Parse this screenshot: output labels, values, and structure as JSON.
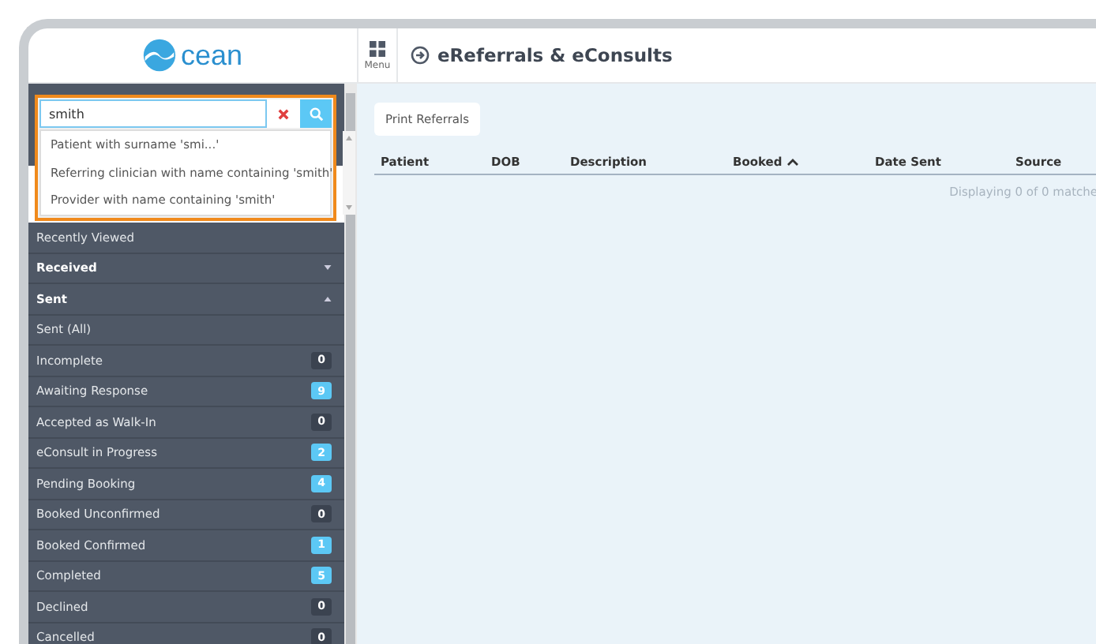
{
  "logo": {
    "text": "cean"
  },
  "header": {
    "menu_label": "Menu",
    "title": "eReferrals & eConsults"
  },
  "search": {
    "value": "smith",
    "suggestions": [
      "Patient with surname 'smi...'",
      "Referring clinician with name containing 'smith'",
      "Provider with name containing 'smith'"
    ]
  },
  "sidebar": {
    "items": [
      {
        "kind": "link",
        "label": "Recently Viewed"
      },
      {
        "kind": "section",
        "label": "Received",
        "expanded": false
      },
      {
        "kind": "section",
        "label": "Sent",
        "expanded": true
      },
      {
        "kind": "link",
        "label": "Sent (All)"
      },
      {
        "kind": "count",
        "label": "Incomplete",
        "count": "0",
        "color": "#3b4350"
      },
      {
        "kind": "count",
        "label": "Awaiting Response",
        "count": "9",
        "color": "#5cc8f5"
      },
      {
        "kind": "count",
        "label": "Accepted as Walk-In",
        "count": "0",
        "color": "#3b4350"
      },
      {
        "kind": "count",
        "label": "eConsult in Progress",
        "count": "2",
        "color": "#5cc8f5"
      },
      {
        "kind": "count",
        "label": "Pending Booking",
        "count": "4",
        "color": "#5cc8f5"
      },
      {
        "kind": "count",
        "label": "Booked Unconfirmed",
        "count": "0",
        "color": "#3b4350"
      },
      {
        "kind": "count",
        "label": "Booked Confirmed",
        "count": "1",
        "color": "#5cc8f5"
      },
      {
        "kind": "count",
        "label": "Completed",
        "count": "5",
        "color": "#5cc8f5"
      },
      {
        "kind": "count",
        "label": "Declined",
        "count": "0",
        "color": "#3b4350"
      },
      {
        "kind": "count",
        "label": "Cancelled",
        "count": "0",
        "color": "#3b4350"
      }
    ]
  },
  "toolbar": {
    "button": "Print Referrals"
  },
  "table": {
    "columns": [
      {
        "label": "Patient",
        "sorted": false
      },
      {
        "label": "DOB",
        "sorted": false
      },
      {
        "label": "Description",
        "sorted": false
      },
      {
        "label": "Booked",
        "sorted": true
      },
      {
        "label": "Date Sent",
        "sorted": false
      },
      {
        "label": "Source",
        "sorted": false
      }
    ],
    "footer": "Displaying 0 of 0 matche"
  }
}
